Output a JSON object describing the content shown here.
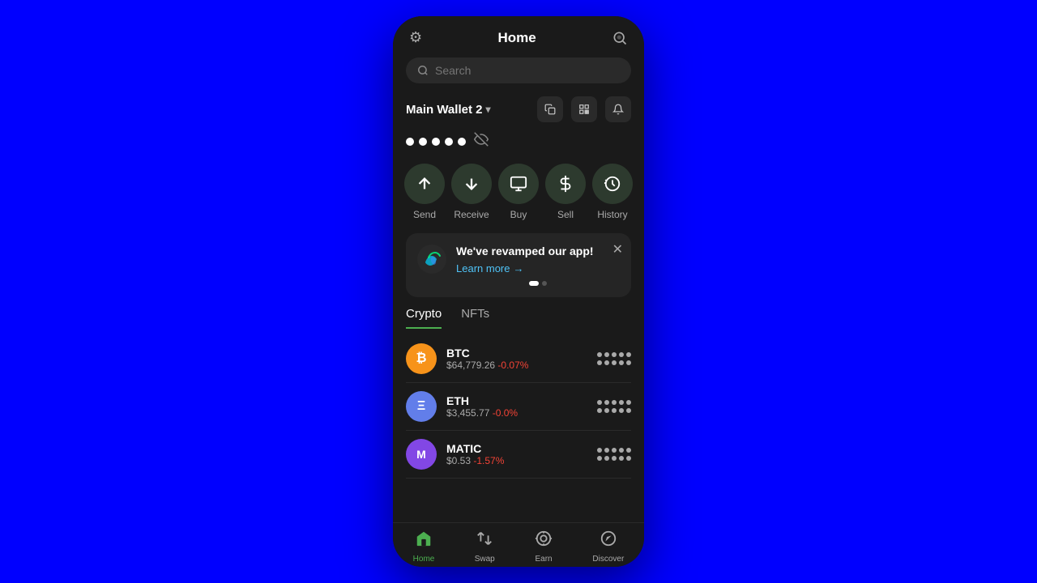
{
  "app": {
    "background_color": "#0000ff",
    "phone_bg": "#1a1a1a"
  },
  "header": {
    "title": "Home",
    "settings_icon": "⚙",
    "scan_icon": "⊙"
  },
  "search": {
    "placeholder": "Search"
  },
  "wallet": {
    "name": "Main Wallet 2",
    "copy_icon": "⧉",
    "scan_icon": "⊞",
    "bell_icon": "🔔"
  },
  "balance_dots": [
    "●",
    "●",
    "●",
    "●",
    "●"
  ],
  "actions": [
    {
      "id": "send",
      "label": "Send",
      "icon": "↑"
    },
    {
      "id": "receive",
      "label": "Receive",
      "icon": "↓"
    },
    {
      "id": "buy",
      "label": "Buy",
      "icon": "▦"
    },
    {
      "id": "sell",
      "label": "Sell",
      "icon": "🏛"
    },
    {
      "id": "history",
      "label": "History",
      "icon": "⌚"
    }
  ],
  "banner": {
    "title": "We've revamped our app!",
    "link_text": "Learn more",
    "link_arrow": "→",
    "dots": [
      {
        "active": true
      },
      {
        "active": false
      }
    ]
  },
  "tabs": [
    {
      "id": "crypto",
      "label": "Crypto",
      "active": true
    },
    {
      "id": "nfts",
      "label": "NFTs",
      "active": false
    }
  ],
  "assets": [
    {
      "id": "btc",
      "symbol": "BTC",
      "logo_char": "₿",
      "logo_bg": "#f7931a",
      "price": "$64,779.26",
      "change": "-0.07%",
      "change_color": "#f44336"
    },
    {
      "id": "eth",
      "symbol": "ETH",
      "logo_char": "Ξ",
      "logo_bg": "#627eea",
      "price": "$3,455.77",
      "change": "-0.0%",
      "change_color": "#f44336"
    },
    {
      "id": "matic",
      "symbol": "MATIC",
      "logo_char": "M",
      "logo_bg": "#8247e5",
      "price": "$0.53",
      "change": "-1.57%",
      "change_color": "#f44336"
    }
  ],
  "bottom_nav": [
    {
      "id": "home",
      "label": "Home",
      "icon": "⌂",
      "active": true
    },
    {
      "id": "swap",
      "label": "Swap",
      "icon": "⇄",
      "active": false
    },
    {
      "id": "earn",
      "label": "Earn",
      "icon": "◎",
      "active": false
    },
    {
      "id": "discover",
      "label": "Discover",
      "icon": "◉",
      "active": false
    }
  ]
}
